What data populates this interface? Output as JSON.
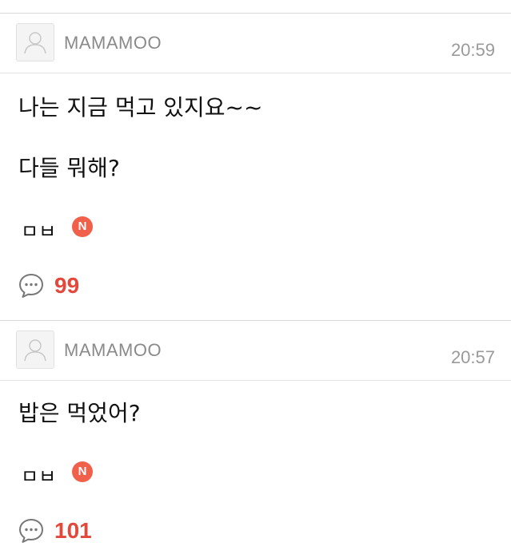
{
  "colors": {
    "accent_red": "#e2483b",
    "badge_red": "#f0604b",
    "muted_text": "#8a8a8a",
    "divider": "#d9d9d9"
  },
  "posts": [
    {
      "author": "MAMAMOO",
      "time": "20:59",
      "lines": [
        "나는 지금 먹고 있지요~~",
        "다들 뭐해?"
      ],
      "signature": "ㅁㅂ",
      "badge": "N",
      "comment_count": "99",
      "icons": {
        "avatar": "default-avatar-icon",
        "comment": "speech-bubble-icon"
      }
    },
    {
      "author": "MAMAMOO",
      "time": "20:57",
      "lines": [
        "밥은 먹었어?"
      ],
      "signature": "ㅁㅂ",
      "badge": "N",
      "comment_count": "101",
      "icons": {
        "avatar": "default-avatar-icon",
        "comment": "speech-bubble-icon"
      }
    }
  ]
}
